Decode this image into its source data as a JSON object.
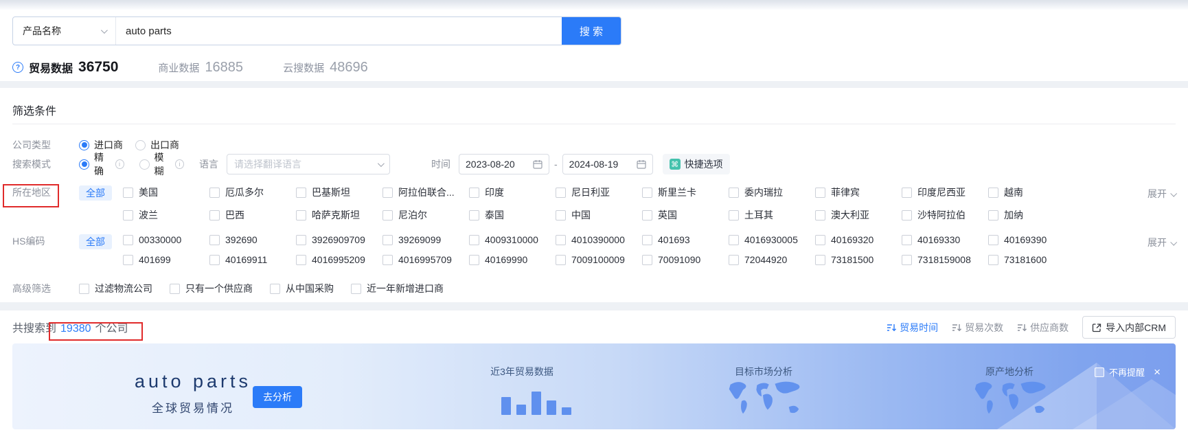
{
  "colors": {
    "primary": "#2b7bf8",
    "teal": "#45c2ad",
    "annotation_red": "#e02a2a"
  },
  "search": {
    "category": "产品名称",
    "query": "auto parts",
    "button": "搜 索"
  },
  "tabs": {
    "trade": {
      "label": "贸易数据",
      "count": "36750"
    },
    "business": {
      "label": "商业数据",
      "count": "16885"
    },
    "cloud": {
      "label": "云搜数据",
      "count": "48696"
    }
  },
  "filters": {
    "title": "筛选条件",
    "company_type": {
      "label": "公司类型",
      "importer": "进口商",
      "exporter": "出口商"
    },
    "search_mode": {
      "label": "搜索模式",
      "exact": "精确",
      "fuzzy": "模糊"
    },
    "language": {
      "label": "语言",
      "placeholder": "请选择翻译语言"
    },
    "time": {
      "label": "时间",
      "start": "2023-08-20",
      "separator": "-",
      "end": "2024-08-19",
      "quick": "快捷选项"
    },
    "region": {
      "label": "所在地区",
      "all": "全部",
      "expand": "展开",
      "row1": [
        "美国",
        "厄瓜多尔",
        "巴基斯坦",
        "阿拉伯联合...",
        "印度",
        "尼日利亚",
        "斯里兰卡",
        "委内瑞拉",
        "菲律宾",
        "印度尼西亚",
        "越南"
      ],
      "row2": [
        "波兰",
        "巴西",
        "哈萨克斯坦",
        "尼泊尔",
        "泰国",
        "中国",
        "英国",
        "土耳其",
        "澳大利亚",
        "沙特阿拉伯",
        "加纳"
      ]
    },
    "hs_code": {
      "label": "HS编码",
      "all": "全部",
      "expand": "展开",
      "row1": [
        "00330000",
        "392690",
        "3926909709",
        "39269099",
        "4009310000",
        "4010390000",
        "401693",
        "4016930005",
        "40169320",
        "40169330",
        "40169390"
      ],
      "row2": [
        "401699",
        "40169911",
        "4016995209",
        "4016995709",
        "40169990",
        "7009100009",
        "70091090",
        "72044920",
        "73181500",
        "7318159008",
        "73181600"
      ]
    },
    "advanced": {
      "label": "高级筛选",
      "options": [
        "过滤物流公司",
        "只有一个供应商",
        "从中国采购",
        "近一年新增进口商"
      ]
    }
  },
  "results": {
    "prefix": "共搜索到",
    "count": "19380",
    "suffix": "个公司",
    "sorts": {
      "time": "贸易时间",
      "frequency": "贸易次数",
      "suppliers": "供应商数"
    },
    "import_button": "导入内部CRM"
  },
  "banner": {
    "title": "auto parts",
    "subtitle": "全球贸易情况",
    "analyze": "去分析",
    "card1": "近3年贸易数据",
    "card2": "目标市场分析",
    "card3": "原产地分析",
    "dismiss": "不再提醒",
    "close": "×",
    "bars": [
      26,
      15,
      34,
      21,
      11
    ]
  }
}
